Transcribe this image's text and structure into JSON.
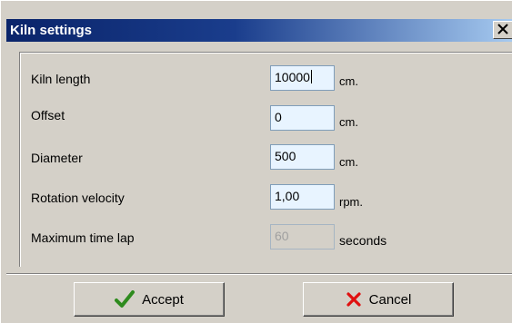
{
  "window": {
    "title": "Kiln settings",
    "close_glyph": "✕"
  },
  "fields": [
    {
      "label": "Kiln length",
      "value": "10000",
      "unit": "cm.",
      "enabled": true,
      "focused": true
    },
    {
      "label": "Offset",
      "value": "0",
      "unit": "cm.",
      "enabled": true
    },
    {
      "label": "Diameter",
      "value": "500",
      "unit": "cm.",
      "enabled": true
    },
    {
      "label": "Rotation velocity",
      "value": "1,00",
      "unit": "rpm.",
      "enabled": true
    },
    {
      "label": "Maximum time lap",
      "value": "60",
      "unit": "seconds",
      "enabled": false
    }
  ],
  "buttons": {
    "accept_label": "Accept",
    "accept_icon": "checkmark-icon",
    "cancel_label": "Cancel",
    "cancel_icon": "x-icon"
  },
  "colors": {
    "title_bar_start": "#0a246a",
    "title_bar_end": "#a6caf0",
    "dialog_bg": "#d4d0c8",
    "field_bg": "#e8f4ff",
    "accept_check": "#2e8b1e",
    "cancel_x": "#e01010"
  }
}
